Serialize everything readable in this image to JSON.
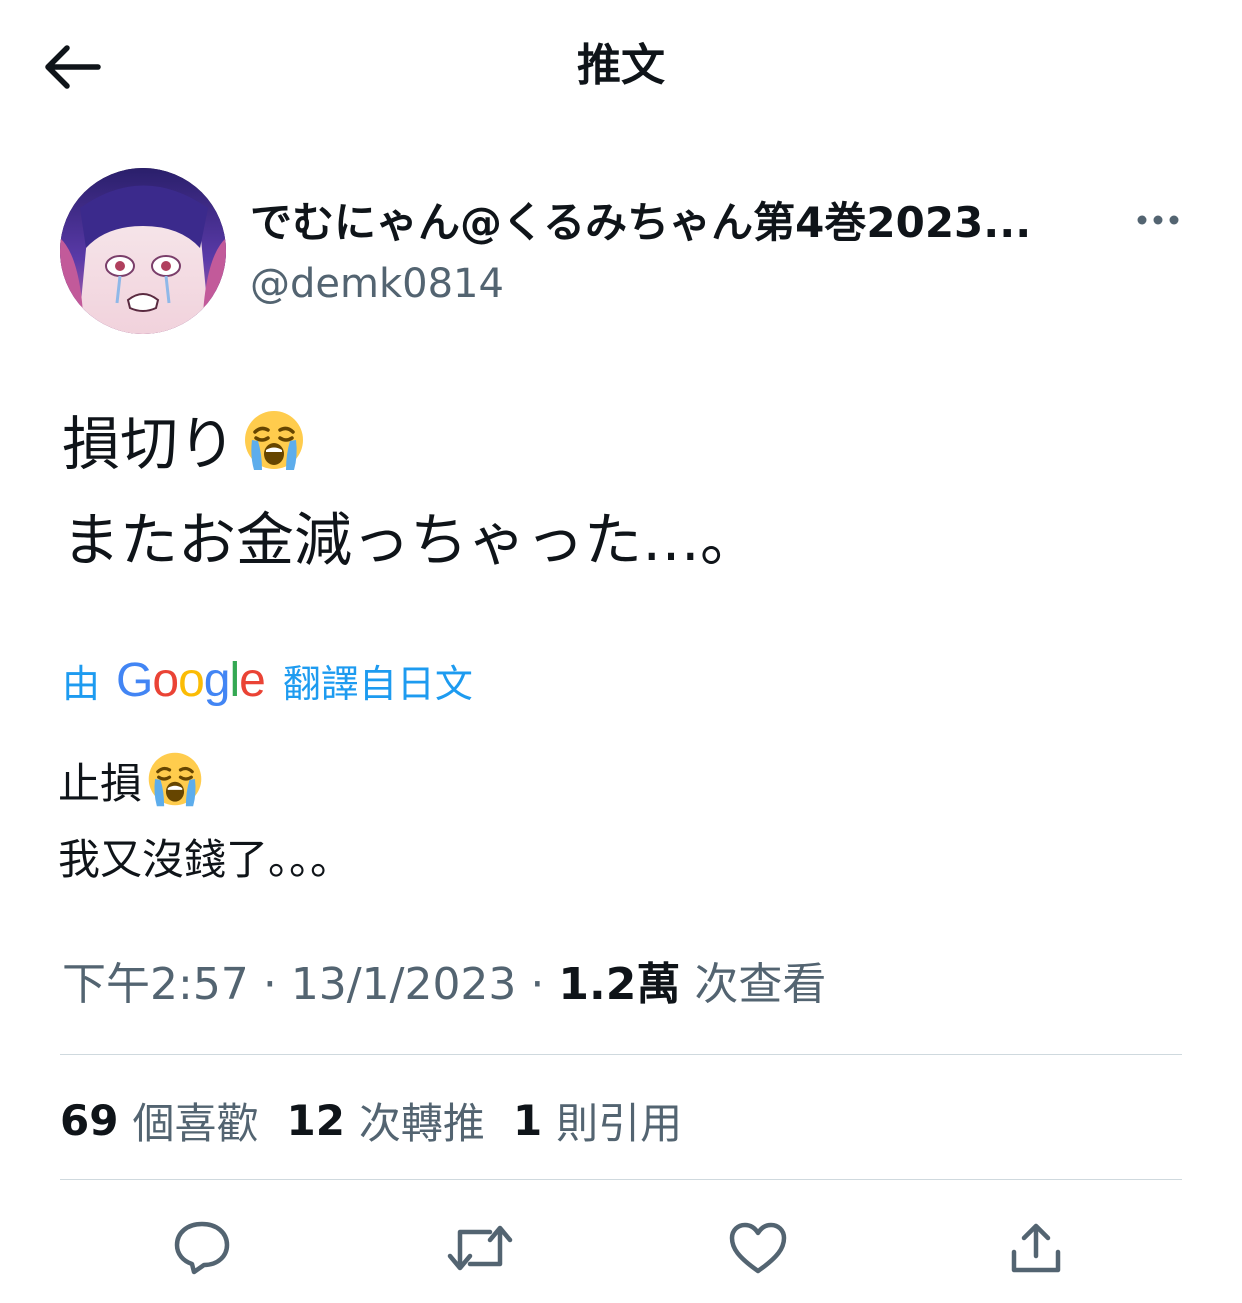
{
  "header": {
    "title": "推文",
    "back_icon": "arrow-left-icon"
  },
  "author": {
    "display_name": "でむにゃん@くるみちゃん第4巻2023...",
    "handle": "@demk0814",
    "more_icon": "more-horizontal-icon"
  },
  "tweet": {
    "line1": "損切り",
    "line2": "またお金減っちゃった…。",
    "emoji": "loudly-crying-face-emoji"
  },
  "translation": {
    "prefix": "由",
    "provider_letters": [
      "G",
      "o",
      "o",
      "g",
      "l",
      "e"
    ],
    "suffix": "翻譯自日文",
    "line1": "止損",
    "line2": "我又沒錢了。。。"
  },
  "meta": {
    "time": "下午2:57",
    "date": "13/1/2023",
    "separator": "·",
    "views_count": "1.2萬",
    "views_label": "次查看"
  },
  "stats": {
    "likes_count": "69",
    "likes_label": "個喜歡",
    "retweets_count": "12",
    "retweets_label": "次轉推",
    "quotes_count": "1",
    "quotes_label": "則引用"
  },
  "actions": {
    "reply_icon": "reply-icon",
    "retweet_icon": "retweet-icon",
    "like_icon": "heart-icon",
    "share_icon": "share-icon"
  },
  "colors": {
    "text": "#0f1419",
    "secondary": "#536471",
    "link": "#1d9bf0",
    "divider": "#cfd9de"
  }
}
